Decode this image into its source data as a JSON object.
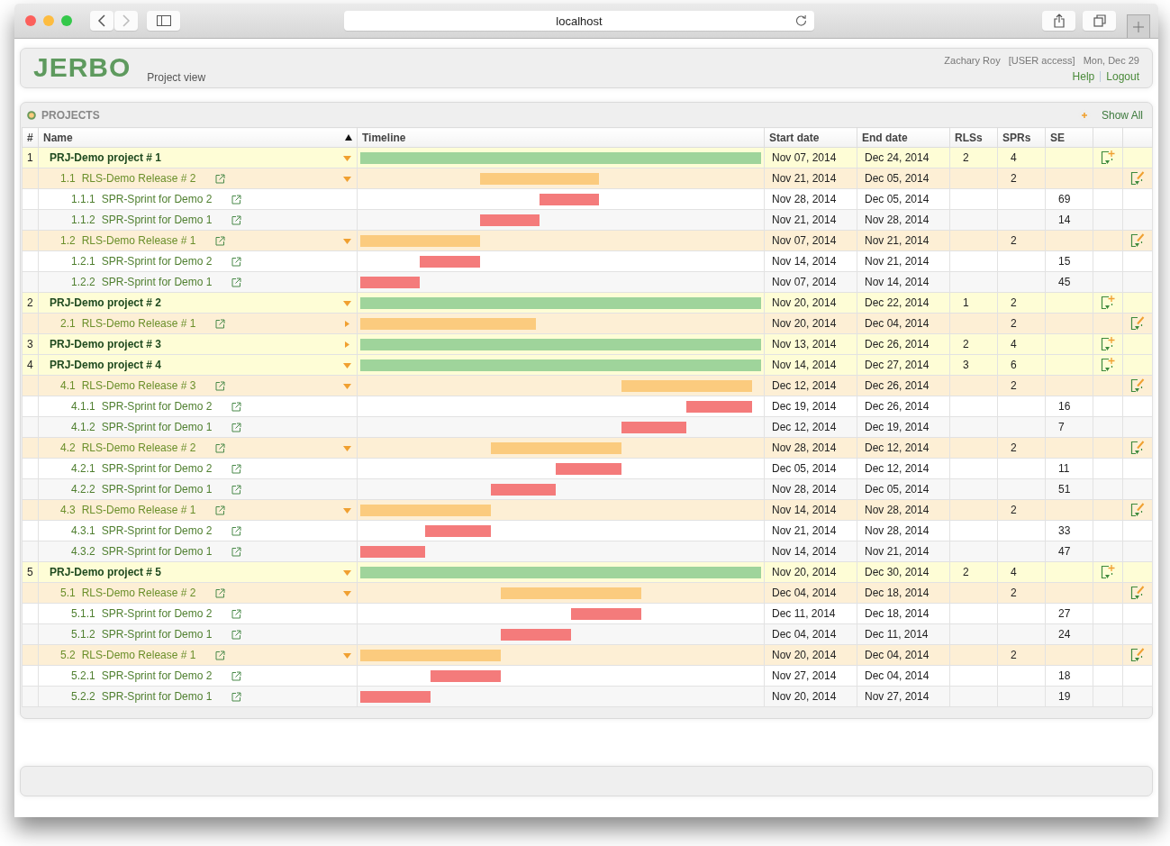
{
  "browser": {
    "url": "localhost"
  },
  "header": {
    "logo": "JERBO",
    "subtitle": "Project view",
    "user": "Zachary Roy",
    "access": "[USER access]",
    "date": "Mon, Dec 29",
    "links": [
      "Help",
      "Logout"
    ]
  },
  "panel": {
    "title": "PROJECTS",
    "show_all": "Show All"
  },
  "columns": [
    "#",
    "Name",
    "Timeline",
    "Start date",
    "End date",
    "RLSs",
    "SPRs",
    "SE"
  ],
  "projects": [
    {
      "num": "1",
      "name": "PRJ-Demo project # 1",
      "expanded": true,
      "start": "Nov 07, 2014",
      "end": "Dec 24, 2014",
      "rls": "2",
      "sprs": "4",
      "children": [
        {
          "num": "1.1",
          "name": "RLS-Demo Release # 2",
          "expanded": true,
          "start": "Nov 21, 2014",
          "end": "Dec 05, 2014",
          "sprs": "2",
          "children": [
            {
              "num": "1.1.1",
              "name": "SPR-Sprint for Demo 2",
              "start": "Nov 28, 2014",
              "end": "Dec 05, 2014",
              "se": "69"
            },
            {
              "num": "1.1.2",
              "name": "SPR-Sprint for Demo 1",
              "start": "Nov 21, 2014",
              "end": "Nov 28, 2014",
              "se": "14"
            }
          ]
        },
        {
          "num": "1.2",
          "name": "RLS-Demo Release # 1",
          "expanded": true,
          "start": "Nov 07, 2014",
          "end": "Nov 21, 2014",
          "sprs": "2",
          "children": [
            {
              "num": "1.2.1",
              "name": "SPR-Sprint for Demo 2",
              "start": "Nov 14, 2014",
              "end": "Nov 21, 2014",
              "se": "15"
            },
            {
              "num": "1.2.2",
              "name": "SPR-Sprint for Demo 1",
              "start": "Nov 07, 2014",
              "end": "Nov 14, 2014",
              "se": "45"
            }
          ]
        }
      ]
    },
    {
      "num": "2",
      "name": "PRJ-Demo project # 2",
      "expanded": true,
      "start": "Nov 20, 2014",
      "end": "Dec 22, 2014",
      "rls": "1",
      "sprs": "2",
      "children": [
        {
          "num": "2.1",
          "name": "RLS-Demo Release # 1",
          "expanded": false,
          "start": "Nov 20, 2014",
          "end": "Dec 04, 2014",
          "sprs": "2"
        }
      ]
    },
    {
      "num": "3",
      "name": "PRJ-Demo project # 3",
      "expanded": false,
      "start": "Nov 13, 2014",
      "end": "Dec 26, 2014",
      "rls": "2",
      "sprs": "4"
    },
    {
      "num": "4",
      "name": "PRJ-Demo project # 4",
      "expanded": true,
      "start": "Nov 14, 2014",
      "end": "Dec 27, 2014",
      "rls": "3",
      "sprs": "6",
      "children": [
        {
          "num": "4.1",
          "name": "RLS-Demo Release # 3",
          "expanded": true,
          "start": "Dec 12, 2014",
          "end": "Dec 26, 2014",
          "sprs": "2",
          "children": [
            {
              "num": "4.1.1",
              "name": "SPR-Sprint for Demo 2",
              "start": "Dec 19, 2014",
              "end": "Dec 26, 2014",
              "se": "16"
            },
            {
              "num": "4.1.2",
              "name": "SPR-Sprint for Demo 1",
              "start": "Dec 12, 2014",
              "end": "Dec 19, 2014",
              "se": "7"
            }
          ]
        },
        {
          "num": "4.2",
          "name": "RLS-Demo Release # 2",
          "expanded": true,
          "start": "Nov 28, 2014",
          "end": "Dec 12, 2014",
          "sprs": "2",
          "children": [
            {
              "num": "4.2.1",
              "name": "SPR-Sprint for Demo 2",
              "start": "Dec 05, 2014",
              "end": "Dec 12, 2014",
              "se": "11"
            },
            {
              "num": "4.2.2",
              "name": "SPR-Sprint for Demo 1",
              "start": "Nov 28, 2014",
              "end": "Dec 05, 2014",
              "se": "51"
            }
          ]
        },
        {
          "num": "4.3",
          "name": "RLS-Demo Release # 1",
          "expanded": true,
          "start": "Nov 14, 2014",
          "end": "Nov 28, 2014",
          "sprs": "2",
          "children": [
            {
              "num": "4.3.1",
              "name": "SPR-Sprint for Demo 2",
              "start": "Nov 21, 2014",
              "end": "Nov 28, 2014",
              "se": "33"
            },
            {
              "num": "4.3.2",
              "name": "SPR-Sprint for Demo 1",
              "start": "Nov 14, 2014",
              "end": "Nov 21, 2014",
              "se": "47"
            }
          ]
        }
      ]
    },
    {
      "num": "5",
      "name": "PRJ-Demo project # 5",
      "expanded": true,
      "start": "Nov 20, 2014",
      "end": "Dec 30, 2014",
      "rls": "2",
      "sprs": "4",
      "children": [
        {
          "num": "5.1",
          "name": "RLS-Demo Release # 2",
          "expanded": true,
          "start": "Dec 04, 2014",
          "end": "Dec 18, 2014",
          "sprs": "2",
          "children": [
            {
              "num": "5.1.1",
              "name": "SPR-Sprint for Demo 2",
              "start": "Dec 11, 2014",
              "end": "Dec 18, 2014",
              "se": "27"
            },
            {
              "num": "5.1.2",
              "name": "SPR-Sprint for Demo 1",
              "start": "Dec 04, 2014",
              "end": "Dec 11, 2014",
              "se": "24"
            }
          ]
        },
        {
          "num": "5.2",
          "name": "RLS-Demo Release # 1",
          "expanded": true,
          "start": "Nov 20, 2014",
          "end": "Dec 04, 2014",
          "sprs": "2",
          "children": [
            {
              "num": "5.2.1",
              "name": "SPR-Sprint for Demo 2",
              "start": "Nov 27, 2014",
              "end": "Dec 04, 2014",
              "se": "18"
            },
            {
              "num": "5.2.2",
              "name": "SPR-Sprint for Demo 1",
              "start": "Nov 20, 2014",
              "end": "Nov 27, 2014",
              "se": "19"
            }
          ]
        }
      ]
    }
  ]
}
